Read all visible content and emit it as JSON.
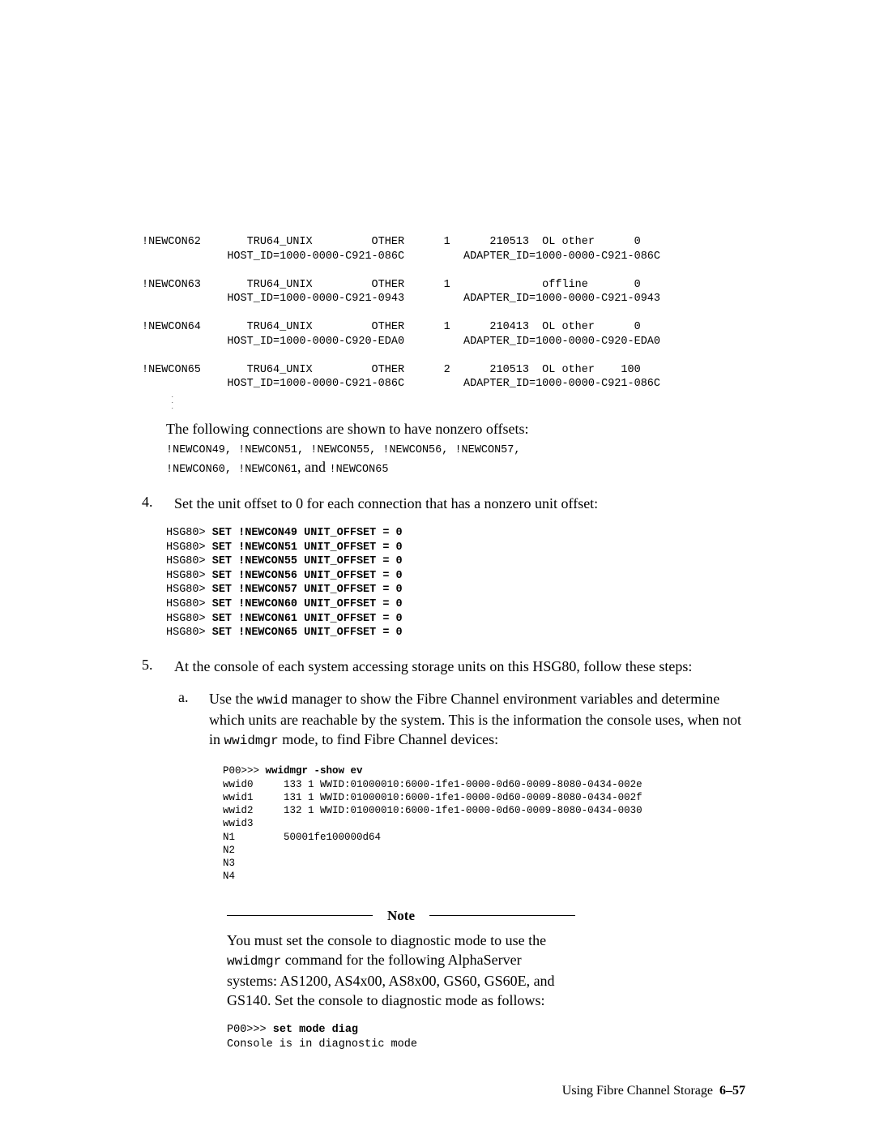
{
  "connections_block": "!NEWCON62       TRU64_UNIX         OTHER      1      210513  OL other      0\n             HOST_ID=1000-0000-C921-086C         ADAPTER_ID=1000-0000-C921-086C\n\n!NEWCON63       TRU64_UNIX         OTHER      1              offline       0\n             HOST_ID=1000-0000-C921-0943         ADAPTER_ID=1000-0000-C921-0943\n\n!NEWCON64       TRU64_UNIX         OTHER      1      210413  OL other      0\n             HOST_ID=1000-0000-C920-EDA0         ADAPTER_ID=1000-0000-C920-EDA0\n\n!NEWCON65       TRU64_UNIX         OTHER      2      210513  OL other    100\n             HOST_ID=1000-0000-C921-086C         ADAPTER_ID=1000-0000-C921-086C",
  "dots": "          .\n          .\n          .",
  "nonzero_intro": "The following connections are shown to have nonzero offsets:",
  "nonzero_list1": "!NEWCON49, !NEWCON51, !NEWCON55, !NEWCON56, !NEWCON57,",
  "nonzero_list2_a": "!NEWCON60, !NEWCON61",
  "nonzero_list2_b": ", and ",
  "nonzero_list2_c": "!NEWCON65",
  "step4_num": "4.",
  "step4_text": "Set the unit offset to 0 for each connection that has a nonzero unit offset:",
  "set_block_lines": [
    {
      "p": "HSG80> ",
      "c": "SET !NEWCON49 UNIT_OFFSET = 0"
    },
    {
      "p": "HSG80> ",
      "c": "SET !NEWCON51 UNIT_OFFSET = 0"
    },
    {
      "p": "HSG80> ",
      "c": "SET !NEWCON55 UNIT_OFFSET = 0"
    },
    {
      "p": "HSG80> ",
      "c": "SET !NEWCON56 UNIT_OFFSET = 0"
    },
    {
      "p": "HSG80> ",
      "c": "SET !NEWCON57 UNIT_OFFSET = 0"
    },
    {
      "p": "HSG80> ",
      "c": "SET !NEWCON60 UNIT_OFFSET = 0"
    },
    {
      "p": "HSG80> ",
      "c": "SET !NEWCON61 UNIT_OFFSET = 0"
    },
    {
      "p": "HSG80> ",
      "c": "SET !NEWCON65 UNIT_OFFSET = 0"
    }
  ],
  "step5_num": "5.",
  "step5_text": "At the console of each system accessing storage units on this HSG80, follow these steps:",
  "step5a_letter": "a.",
  "step5a_seg1": "Use the ",
  "step5a_code1": "wwid",
  "step5a_seg2": " manager to show the Fibre Channel environment variables and determine which units are reachable by the system. This is the information the console uses, when not in ",
  "step5a_code2": "wwidmgr",
  "step5a_seg3": " mode, to find Fibre Channel devices:",
  "wwid_prompt": "P00>>> ",
  "wwid_cmd": "wwidmgr -show ev",
  "wwid_body": "wwid0     133 1 WWID:01000010:6000-1fe1-0000-0d60-0009-8080-0434-002e\nwwid1     131 1 WWID:01000010:6000-1fe1-0000-0d60-0009-8080-0434-002f\nwwid2     132 1 WWID:01000010:6000-1fe1-0000-0d60-0009-8080-0434-0030\nwwid3\nN1        50001fe100000d64\nN2\nN3\nN4",
  "note_title": "Note",
  "note_seg1": "You must set the console to diagnostic mode to use the ",
  "note_code1": "wwidmgr",
  "note_seg2": " command for the following AlphaServer systems: AS1200, AS4x00, AS8x00, GS60, GS60E, and GS140. Set the console to diagnostic mode as follows:",
  "note_prompt": "P00>>> ",
  "note_cmd": "set mode diag",
  "note_out": "Console is in diagnostic mode",
  "footer_text": "Using Fibre Channel Storage",
  "footer_page": "6–57"
}
